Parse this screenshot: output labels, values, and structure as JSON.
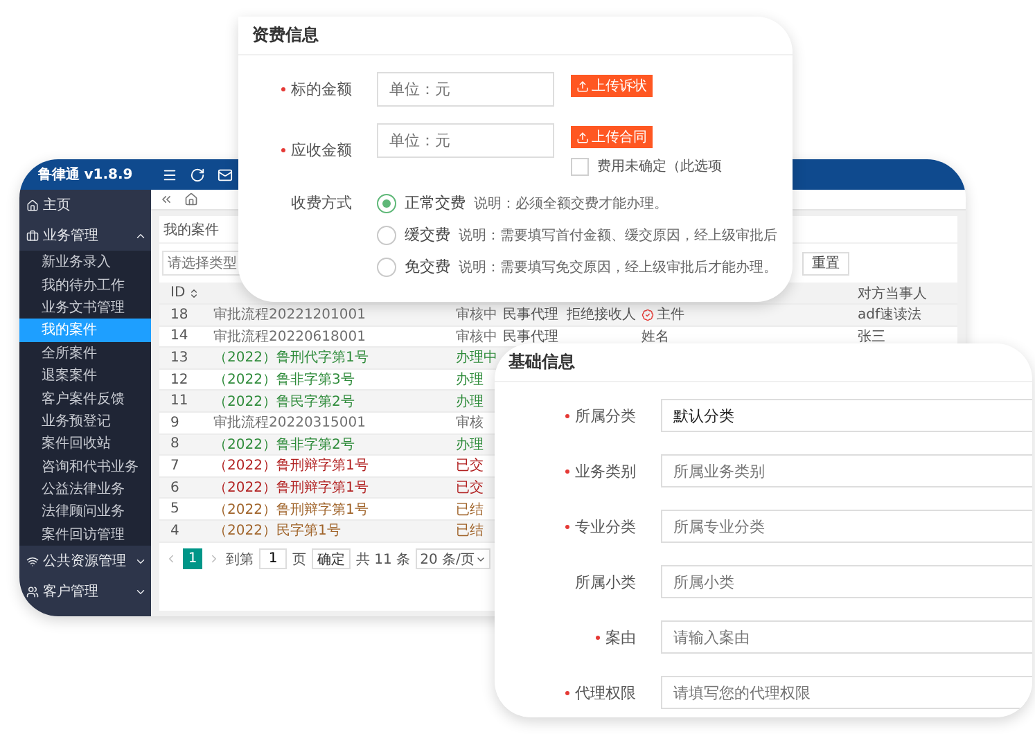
{
  "app": {
    "logo": "鲁律通 v1.8.9",
    "sidebar": [
      {
        "kind": "home",
        "label": "主页"
      },
      {
        "kind": "business",
        "label": "业务管理",
        "expanded": true,
        "children": [
          {
            "label": "新业务录入",
            "selected": false
          },
          {
            "label": "我的待办工作",
            "selected": false
          },
          {
            "label": "业务文书管理",
            "selected": false
          },
          {
            "label": "我的案件",
            "selected": true
          },
          {
            "label": "全所案件",
            "selected": false
          },
          {
            "label": "退案案件",
            "selected": false
          },
          {
            "label": "客户案件反馈",
            "selected": false
          },
          {
            "label": "业务预登记",
            "selected": false
          },
          {
            "label": "案件回收站",
            "selected": false
          },
          {
            "label": "咨询和代书业务",
            "selected": false
          },
          {
            "label": "公益法律业务",
            "selected": false
          },
          {
            "label": "法律顾问业务",
            "selected": false
          },
          {
            "label": "案件回访管理",
            "selected": false
          }
        ]
      },
      {
        "kind": "resources",
        "label": "公共资源管理",
        "expanded": false
      },
      {
        "kind": "customers",
        "label": "客户管理",
        "expanded": false
      }
    ],
    "breadcrumb": "我的案件",
    "filter": {
      "placeholder": "请选择类型"
    },
    "reset_button": "重置",
    "table": {
      "columns": [
        {
          "label": "ID",
          "sortable": true
        },
        {
          "label": "对方当事人",
          "sortable": false
        }
      ],
      "rows": [
        {
          "id": "18",
          "case": "审批流程20221201001",
          "status": "审核中",
          "type": "民事代理",
          "person": "拒绝接收人",
          "document": "主件",
          "document_icon": true,
          "party": "adf速读法",
          "color": "#707070"
        },
        {
          "id": "14",
          "case": "审批流程20220618001",
          "status": "审核中",
          "type": "民事代理",
          "document": "姓名",
          "document_icon": false,
          "party": "张三",
          "color": "#707070"
        },
        {
          "id": "13",
          "case": "（2022）鲁刑代字第1号",
          "status": "办理中",
          "color": "#2e8b3a"
        },
        {
          "id": "12",
          "case": "（2022）鲁非字第3号",
          "status": "办理",
          "color": "#2e8b3a"
        },
        {
          "id": "11",
          "case": "（2022）鲁民字第2号",
          "status": "办理",
          "color": "#2e8b3a"
        },
        {
          "id": "9",
          "case": "审批流程20220315001",
          "status": "审核",
          "color": "#707070"
        },
        {
          "id": "8",
          "case": "（2022）鲁非字第2号",
          "status": "办理",
          "color": "#2e8b3a"
        },
        {
          "id": "7",
          "case": "（2022）鲁刑辩字第1号",
          "status": "已交",
          "color": "#b22222"
        },
        {
          "id": "6",
          "case": "（2022）鲁刑辩字第1号",
          "status": "已交",
          "color": "#b22222"
        },
        {
          "id": "5",
          "case": "（2022）鲁刑辩字第1号",
          "status": "已结",
          "color": "#a0642a"
        },
        {
          "id": "4",
          "case": "（2022）民字第1号",
          "status": "已结",
          "color": "#a0642a"
        }
      ]
    },
    "pagination": {
      "pages": [
        {
          "label": "1",
          "selected": true
        }
      ],
      "goto_label": "到第",
      "goto_value": "1",
      "page_unit": "页",
      "confirm": "确定",
      "total": "共 11 条",
      "page_size": "20 条/页"
    }
  },
  "fee_card": {
    "title": "资费信息",
    "amounts": [
      {
        "label": "标的金额",
        "required": true,
        "placeholder": "单位：元",
        "button": "上传诉状"
      },
      {
        "label": "应收金额",
        "required": true,
        "placeholder": "单位：元",
        "button": "上传合同"
      }
    ],
    "undetermined": {
      "label": "费用未确定（此选项",
      "checked": false
    },
    "payment": {
      "label": "收费方式",
      "options": [
        {
          "label": "正常交费",
          "note": "说明：必须全额交费才能办理。",
          "selected": true
        },
        {
          "label": "缓交费",
          "note": "说明：需要填写首付金额、缓交原因，经上级审批后",
          "selected": false
        },
        {
          "label": "免交费",
          "note": "说明：需要填写免交原因，经上级审批后才能办理。",
          "selected": false
        }
      ]
    }
  },
  "basic_card": {
    "title": "基础信息",
    "fields": [
      {
        "label": "所属分类",
        "required": true,
        "value": "默认分类"
      },
      {
        "label": "业务类别",
        "required": true,
        "placeholder": "所属业务类别"
      },
      {
        "label": "专业分类",
        "required": true,
        "placeholder": "所属专业分类"
      },
      {
        "label": "所属小类",
        "required": false,
        "placeholder": "所属小类"
      },
      {
        "label": "案由",
        "required": true,
        "placeholder": "请输入案由"
      },
      {
        "label": "代理权限",
        "required": true,
        "placeholder": "请填写您的代理权限"
      }
    ]
  }
}
